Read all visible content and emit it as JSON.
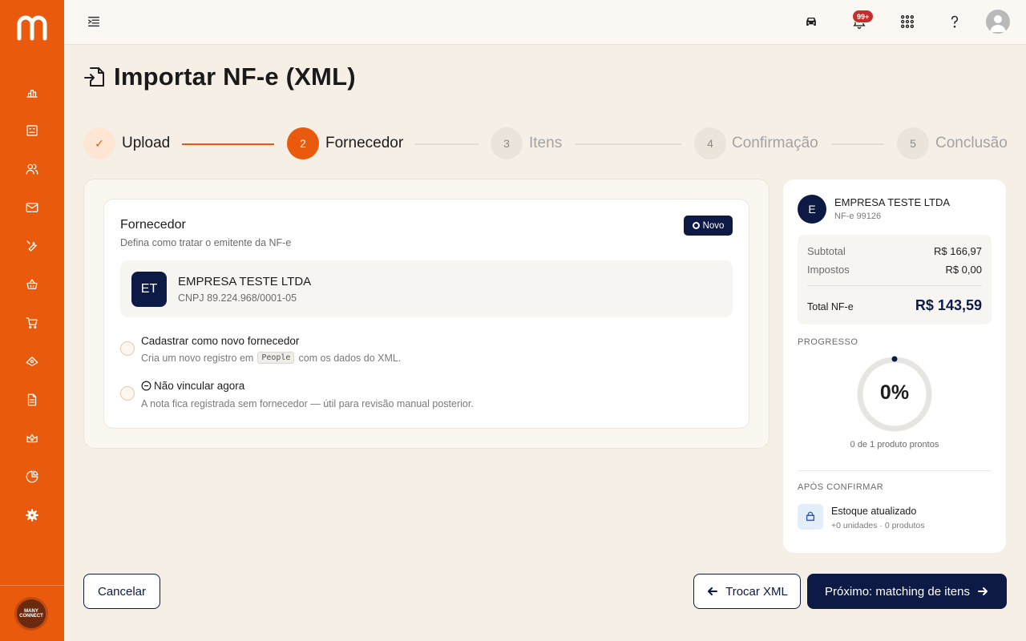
{
  "sidebar": {
    "logo": "m-logo",
    "items": [
      {
        "icon": "chart-bar-icon"
      },
      {
        "icon": "board-icon"
      },
      {
        "icon": "users-icon"
      },
      {
        "icon": "mail-icon"
      },
      {
        "icon": "wrench-icon"
      },
      {
        "icon": "basket-icon"
      },
      {
        "icon": "cart-icon"
      },
      {
        "icon": "money-icon"
      },
      {
        "icon": "document-icon"
      },
      {
        "icon": "crown-icon"
      },
      {
        "icon": "pie-chart-icon"
      },
      {
        "icon": "gear-icon"
      }
    ],
    "brand_text": "MANY CONNECT"
  },
  "topbar": {
    "notifications_badge": "99+",
    "icons": [
      "car-icon",
      "bell-icon",
      "apps-grid-icon",
      "help-icon",
      "user-avatar-icon"
    ]
  },
  "page": {
    "title": "Importar NF-e (XML)"
  },
  "stepper": {
    "steps": [
      {
        "number": "✓",
        "label": "Upload",
        "state": "done"
      },
      {
        "number": "2",
        "label": "Fornecedor",
        "state": "active"
      },
      {
        "number": "3",
        "label": "Itens",
        "state": "pending"
      },
      {
        "number": "4",
        "label": "Confirmação",
        "state": "pending"
      },
      {
        "number": "5",
        "label": "Conclusão",
        "state": "pending"
      }
    ]
  },
  "fornecedor": {
    "title": "Fornecedor",
    "subtitle": "Defina como tratar o emitente da NF-e",
    "badge": "Novo",
    "supplier": {
      "initials": "ET",
      "name": "EMPRESA TESTE LTDA",
      "cnpj": "CNPJ 89.224.968/0001-05"
    },
    "options": [
      {
        "title": "Cadastrar como novo fornecedor",
        "sub_before": "Cria um novo registro em",
        "sub_code": "People",
        "sub_after": "com os dados do XML."
      },
      {
        "title": "Não vincular agora",
        "sub": "A nota fica registrada sem fornecedor — útil para revisão manual posterior."
      }
    ]
  },
  "summary": {
    "avatar": "E",
    "name": "EMPRESA TESTE LTDA",
    "nfe": "NF-e 99126",
    "subtotal_label": "Subtotal",
    "subtotal_value": "R$ 166,97",
    "taxes_label": "Impostos",
    "taxes_value": "R$ 0,00",
    "total_label": "Total NF-e",
    "total_value": "R$ 143,59",
    "progress_label": "PROGRESSO",
    "progress_value": "0%",
    "progress_fraction": 0,
    "progress_sub": "0 de 1 produto prontos",
    "after_label": "APÓS CONFIRMAR",
    "stock_title": "Estoque atualizado",
    "stock_sub": "+0 unidades · 0 produtos"
  },
  "footer": {
    "cancel": "Cancelar",
    "swap_xml": "Trocar XML",
    "next": "Próximo: matching de itens"
  },
  "colors": {
    "brand_orange": "#ea5a0c",
    "navy": "#0c1a45",
    "background": "#f5efe6"
  }
}
